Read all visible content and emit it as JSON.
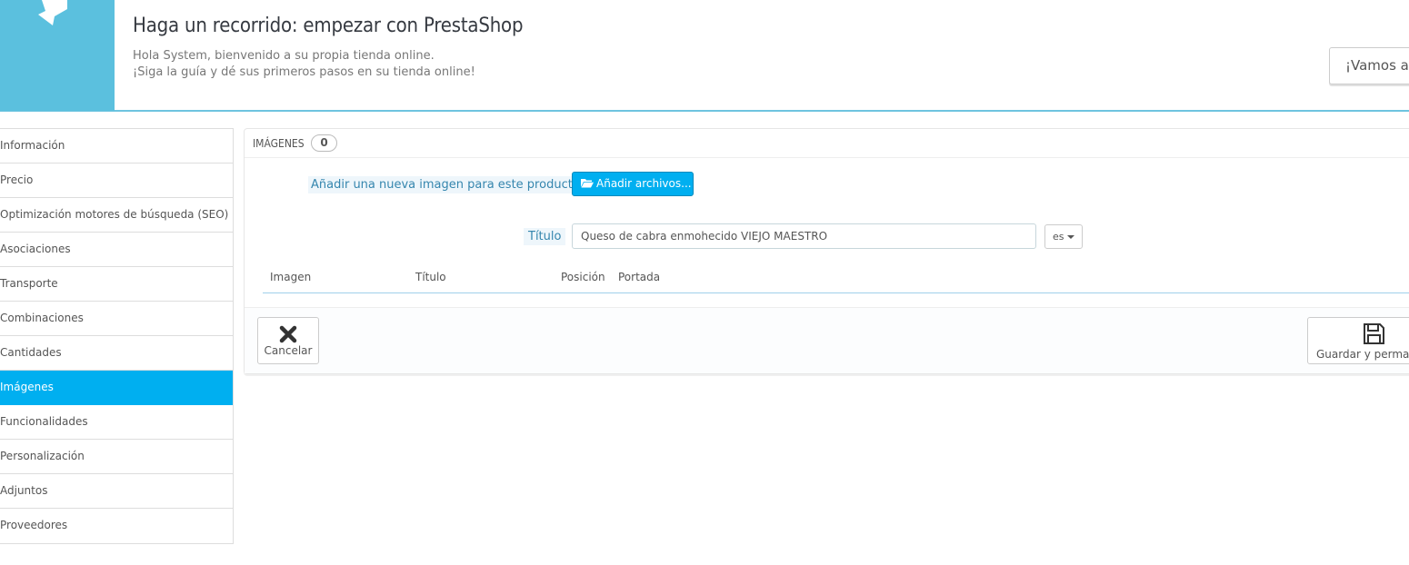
{
  "banner": {
    "title": "Haga un recorrido: empezar con PrestaShop",
    "line1": "Hola System, bienvenido a su propia tienda online.",
    "line2": "¡Siga la guía y dé sus primeros pasos en su tienda online!",
    "start_button": "¡Vamos a e",
    "logo_icon": "puzzle-logo-icon",
    "accent": "#5bc0de"
  },
  "tabs": [
    {
      "label": "Información"
    },
    {
      "label": "Precio"
    },
    {
      "label": "Optimización motores de búsqueda (SEO)"
    },
    {
      "label": "Asociaciones"
    },
    {
      "label": "Transporte"
    },
    {
      "label": "Combinaciones"
    },
    {
      "label": "Cantidades"
    },
    {
      "label": "Imágenes",
      "active": true
    },
    {
      "label": "Funcionalidades"
    },
    {
      "label": "Personalización"
    },
    {
      "label": "Adjuntos"
    },
    {
      "label": "Proveedores"
    }
  ],
  "panel": {
    "heading": "IMÁGENES",
    "count": "0",
    "add_label": "Añadir una nueva imagen para este producto",
    "add_button": "Añadir archivos...",
    "title_label": "Título",
    "title_value": "Queso de cabra enmohecido VIEJO MAESTRO",
    "language": "es",
    "columns": [
      "Imagen",
      "Título",
      "Posición",
      "Portada"
    ],
    "cancel_label": "Cancelar",
    "save_label": "Guardar y perman",
    "active_color": "#00aff0"
  }
}
